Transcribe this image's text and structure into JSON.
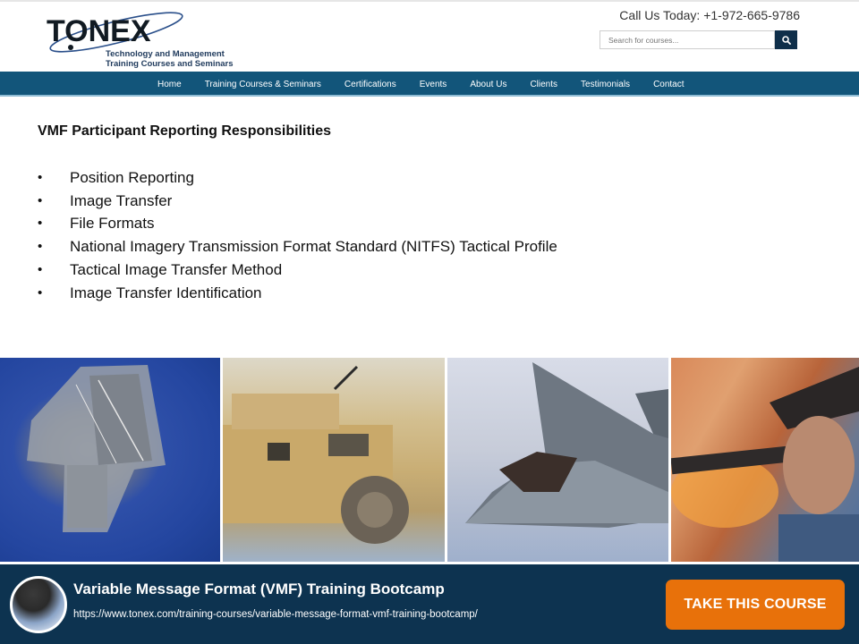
{
  "header": {
    "logo": {
      "wordmark": "TONEX",
      "tagline_line1": "Technology and Management",
      "tagline_line2": "Training Courses and Seminars"
    },
    "phone_text": "Call Us Today: +1-972-665-9786",
    "search": {
      "placeholder": "Search for courses...",
      "value": "",
      "button_icon": "search-icon"
    }
  },
  "nav": {
    "items": [
      {
        "label": "Home"
      },
      {
        "label": "Training Courses & Seminars"
      },
      {
        "label": "Certifications"
      },
      {
        "label": "Events"
      },
      {
        "label": "About Us"
      },
      {
        "label": "Clients"
      },
      {
        "label": "Testimonials"
      },
      {
        "label": "Contact"
      }
    ]
  },
  "content": {
    "title": "VMF Participant Reporting Responsibilities",
    "bullets": [
      "Position Reporting",
      "Image Transfer",
      "File Formats",
      "National Imagery Transmission Format Standard (NITFS) Tactical Profile",
      "Tactical Image Transfer Method",
      "Image Transfer Identification"
    ]
  },
  "photo_strip": {
    "photos": [
      {
        "subject": "aircraft-carrier"
      },
      {
        "subject": "military-humvee"
      },
      {
        "subject": "fighter-jet"
      },
      {
        "subject": "firefighter"
      }
    ]
  },
  "footer": {
    "course_title": "Variable Message Format (VMF) Training Bootcamp",
    "course_url": "https://www.tonex.com/training-courses/variable-message-format-vmf-training-bootcamp/",
    "cta_label": "TAKE THIS COURSE"
  },
  "colors": {
    "nav_bg": "#12557a",
    "footer_bg": "#0d3350",
    "cta_bg": "#e8710a",
    "search_button_bg": "#0f2f4a"
  }
}
